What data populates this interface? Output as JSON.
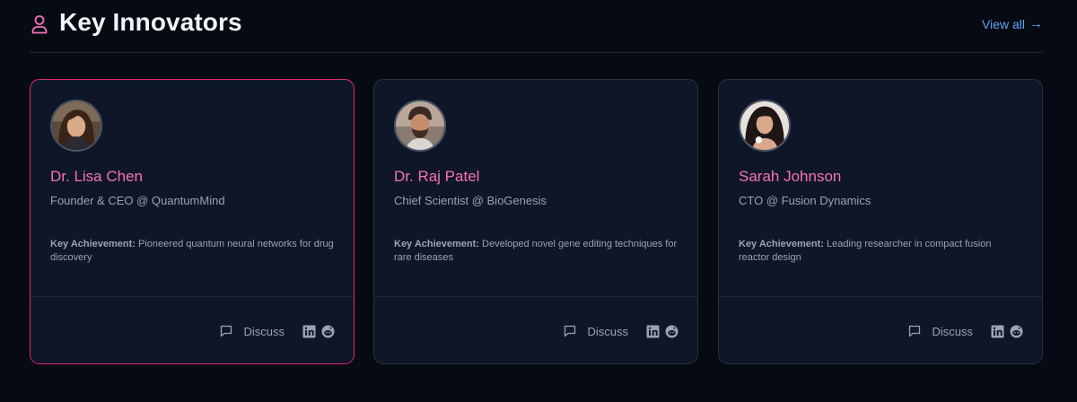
{
  "header": {
    "title": "Key Innovators",
    "view_all_label": "View all",
    "view_all_arrow": "→"
  },
  "colors": {
    "accent": "#f472b6",
    "active_border": "#db2777",
    "link": "#60a5fa",
    "card_bg": "#0f1628",
    "page_bg": "#060a13"
  },
  "cards": [
    {
      "name": "Dr. Lisa Chen",
      "role": "Founder & CEO @ QuantumMind",
      "achievement_label": "Key Achievement:",
      "achievement_text": "Pioneered quantum neural networks for drug discovery",
      "discuss_label": "Discuss",
      "avatar": "woman-avatar"
    },
    {
      "name": "Dr. Raj Patel",
      "role": "Chief Scientist @ BioGenesis",
      "achievement_label": "Key Achievement:",
      "achievement_text": "Developed novel gene editing techniques for rare diseases",
      "discuss_label": "Discuss",
      "avatar": "man-avatar"
    },
    {
      "name": "Sarah Johnson",
      "role": "CTO @ Fusion Dynamics",
      "achievement_label": "Key Achievement:",
      "achievement_text": "Leading researcher in compact fusion reactor design",
      "discuss_label": "Discuss",
      "avatar": "woman-avatar"
    }
  ]
}
